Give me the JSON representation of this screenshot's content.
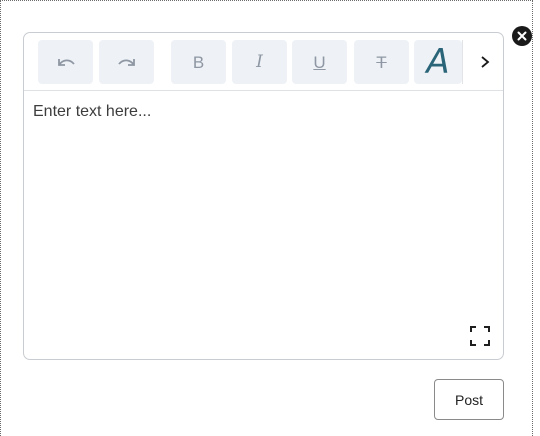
{
  "editor": {
    "placeholder": "Enter text here...",
    "toolbar": {
      "undo_icon": "undo-icon",
      "redo_icon": "redo-icon",
      "bold_label": "B",
      "italic_label": "I",
      "underline_label": "U",
      "strike_label": "T",
      "font_label": "A",
      "more_icon": "chevron-right-icon"
    },
    "expand_icon": "fullscreen-icon"
  },
  "close_icon": "close-icon",
  "actions": {
    "post_label": "Post"
  },
  "colors": {
    "toolbar_button_bg": "#eef2f6",
    "icon_gray": "#8e97a3",
    "font_accent": "#2a6478",
    "close_bg": "#1a1a1a"
  }
}
